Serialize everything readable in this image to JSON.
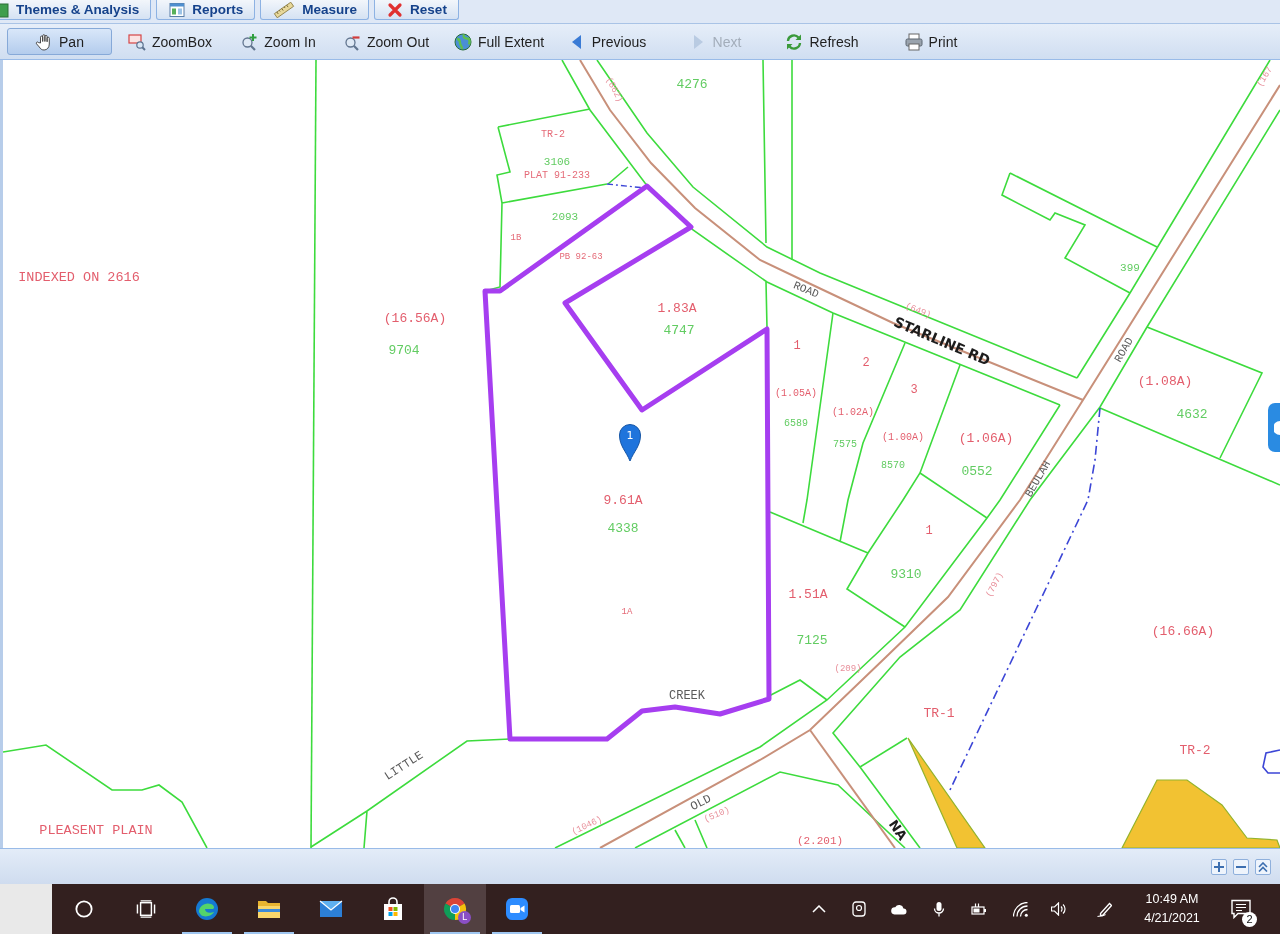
{
  "tabs": [
    {
      "label": "Themes & Analysis"
    },
    {
      "label": "Reports"
    },
    {
      "label": "Measure"
    },
    {
      "label": "Reset"
    }
  ],
  "toolbar": [
    {
      "label": "Pan",
      "selected": true,
      "disabled": false
    },
    {
      "label": "ZoomBox",
      "selected": false,
      "disabled": false
    },
    {
      "label": "Zoom In",
      "selected": false,
      "disabled": false
    },
    {
      "label": "Zoom Out",
      "selected": false,
      "disabled": false
    },
    {
      "label": "Full Extent",
      "selected": false,
      "disabled": false
    },
    {
      "label": "Previous",
      "selected": false,
      "disabled": false
    },
    {
      "label": "Next",
      "selected": false,
      "disabled": true
    },
    {
      "label": "Refresh",
      "selected": false,
      "disabled": false
    },
    {
      "label": "Print",
      "selected": false,
      "disabled": false
    }
  ],
  "map": {
    "labels": [
      {
        "text": "(862)",
        "kind": "road_number"
      },
      {
        "text": "4276",
        "kind": "parcel_number"
      },
      {
        "text": "(167",
        "kind": "road_number"
      },
      {
        "text": "TR-2",
        "kind": "note"
      },
      {
        "text": "3106",
        "kind": "parcel_number"
      },
      {
        "text": "PLAT 91-233",
        "kind": "note"
      },
      {
        "text": "2093",
        "kind": "parcel_number"
      },
      {
        "text": "1B",
        "kind": "note"
      },
      {
        "text": "PB 92-63",
        "kind": "note"
      },
      {
        "text": "399",
        "kind": "parcel_number"
      },
      {
        "text": "INDEXED ON 2616",
        "kind": "acreage"
      },
      {
        "text": "ROAD",
        "kind": "road_name"
      },
      {
        "text": "1.83A",
        "kind": "acreage"
      },
      {
        "text": "(649)",
        "kind": "road_number"
      },
      {
        "text": "(16.56A)",
        "kind": "acreage"
      },
      {
        "text": "4747",
        "kind": "parcel_number"
      },
      {
        "text": "STARLINE RD",
        "kind": "street_name"
      },
      {
        "text": "1",
        "kind": "acreage"
      },
      {
        "text": "ROAD",
        "kind": "road_name"
      },
      {
        "text": "9704",
        "kind": "parcel_number"
      },
      {
        "text": "2",
        "kind": "acreage"
      },
      {
        "text": "(1.08A)",
        "kind": "acreage"
      },
      {
        "text": "3",
        "kind": "acreage"
      },
      {
        "text": "(1.05A)",
        "kind": "acreage"
      },
      {
        "text": "(1.02A)",
        "kind": "acreage"
      },
      {
        "text": "4632",
        "kind": "parcel_number"
      },
      {
        "text": "6589",
        "kind": "parcel_number"
      },
      {
        "text": "7575",
        "kind": "parcel_number"
      },
      {
        "text": "(1.00A)",
        "kind": "acreage"
      },
      {
        "text": "(1.06A)",
        "kind": "acreage"
      },
      {
        "text": "8570",
        "kind": "parcel_number"
      },
      {
        "text": "0552",
        "kind": "parcel_number"
      },
      {
        "text": "BEULAH",
        "kind": "road_name"
      },
      {
        "text": "9.61A",
        "kind": "acreage"
      },
      {
        "text": "4338",
        "kind": "parcel_number"
      },
      {
        "text": "1",
        "kind": "acreage"
      },
      {
        "text": "9310",
        "kind": "parcel_number"
      },
      {
        "text": "(797)",
        "kind": "road_number"
      },
      {
        "text": "1.51A",
        "kind": "acreage"
      },
      {
        "text": "1A",
        "kind": "note"
      },
      {
        "text": "(16.66A)",
        "kind": "acreage"
      },
      {
        "text": "7125",
        "kind": "parcel_number"
      },
      {
        "text": "(209)",
        "kind": "road_number"
      },
      {
        "text": "CREEK",
        "kind": "road_name"
      },
      {
        "text": "TR-1",
        "kind": "acreage"
      },
      {
        "text": "TR-2",
        "kind": "acreage"
      },
      {
        "text": "LITTLE",
        "kind": "road_name"
      },
      {
        "text": "OLD",
        "kind": "road_name"
      },
      {
        "text": "(510)",
        "kind": "road_number"
      },
      {
        "text": "(1046)",
        "kind": "road_number"
      },
      {
        "text": "PLEASENT PLAIN",
        "kind": "acreage"
      },
      {
        "text": "NA",
        "kind": "street_name"
      },
      {
        "text": "(2.201)",
        "kind": "acreage"
      }
    ],
    "marker": {
      "label": "1"
    }
  },
  "taskbar": {
    "apps": [
      {
        "running": true,
        "selected": false
      },
      {
        "running": true,
        "selected": false
      },
      {
        "running": false,
        "selected": false
      },
      {
        "running": false,
        "selected": false
      },
      {
        "running": true,
        "selected": true,
        "badge": "L"
      },
      {
        "running": true,
        "selected": false
      }
    ],
    "clock": {
      "time": "10:49 AM",
      "date": "4/21/2021"
    },
    "notifications": {
      "count": "2"
    }
  }
}
